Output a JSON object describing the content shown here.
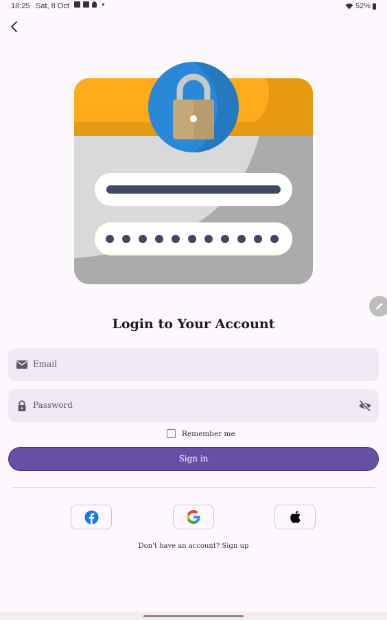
{
  "status_bar": {
    "time": "18:25",
    "date": "Sat, 8 Oct",
    "battery": "52%"
  },
  "icons": {
    "back": "back-arrow-icon",
    "email": "mail-icon",
    "password": "lock-icon",
    "visibility": "eye-off-icon",
    "edit": "pencil-icon",
    "facebook": "facebook-icon",
    "google": "google-icon",
    "apple": "apple-icon"
  },
  "login": {
    "title": "Login to Your Account",
    "email_placeholder": "Email",
    "password_placeholder": "Password",
    "remember_label": "Remember me",
    "remember_checked": false,
    "sign_in_label": "Sign in",
    "signup_prompt": "Don't have an account?",
    "signup_link": "Sign up"
  },
  "colors": {
    "primary": "#674ea7",
    "field_bg": "#efe8f5",
    "background": "#fdf8fd",
    "illustration_header": "#fdab1a",
    "illustration_lock_circle": "#2a88d8",
    "facebook": "#1877f2"
  }
}
